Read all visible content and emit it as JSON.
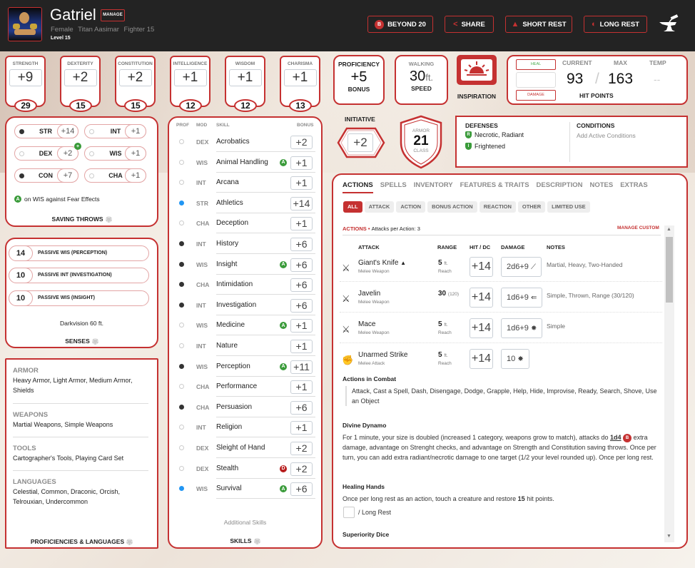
{
  "header": {
    "name": "Gatriel",
    "manage_label": "MANAGE",
    "gender": "Female",
    "race": "Titan Aasimar",
    "class": "Fighter 15",
    "level": "Level 15",
    "buttons": {
      "beyond20": "BEYOND 20",
      "share": "SHARE",
      "short_rest": "SHORT REST",
      "long_rest": "LONG REST"
    }
  },
  "colors": {
    "accent": "#c53131",
    "header_bg": "#232323",
    "advantage": "#3a9b3a",
    "disadvantage": "#b71c1c",
    "proficient_expert": "#2196f3"
  },
  "abilities": [
    {
      "name": "STRENGTH",
      "mod": "+9",
      "score": "29"
    },
    {
      "name": "DEXTERITY",
      "mod": "+2",
      "score": "15"
    },
    {
      "name": "CONSTITUTION",
      "mod": "+2",
      "score": "15"
    },
    {
      "name": "INTELLIGENCE",
      "mod": "+1",
      "score": "12"
    },
    {
      "name": "WISDOM",
      "mod": "+1",
      "score": "12"
    },
    {
      "name": "CHARISMA",
      "mod": "+1",
      "score": "13"
    }
  ],
  "proficiency": {
    "title": "PROFICIENCY",
    "value": "+5",
    "label": "BONUS"
  },
  "speed": {
    "title": "WALKING",
    "value": "30",
    "unit": "ft.",
    "label": "SPEED"
  },
  "inspiration": {
    "label": "INSPIRATION"
  },
  "hit_points": {
    "heal_label": "HEAL",
    "damage_label": "DAMAGE",
    "current_label": "CURRENT",
    "max_label": "MAX",
    "temp_label": "TEMP",
    "current": "93",
    "separator": "/",
    "max": "163",
    "temp": "--",
    "title": "HIT POINTS"
  },
  "saving_throws": {
    "items": [
      {
        "ab": "STR",
        "bonus": "+14",
        "prof": "filled"
      },
      {
        "ab": "INT",
        "bonus": "+1",
        "prof": "empty"
      },
      {
        "ab": "DEX",
        "bonus": "+2",
        "prof": "empty",
        "badge": "+"
      },
      {
        "ab": "WIS",
        "bonus": "+1",
        "prof": "empty"
      },
      {
        "ab": "CON",
        "bonus": "+7",
        "prof": "filled"
      },
      {
        "ab": "CHA",
        "bonus": "+1",
        "prof": "empty"
      }
    ],
    "note_badge": "A",
    "note": "on WIS against Fear Effects",
    "title": "SAVING THROWS"
  },
  "senses": {
    "items": [
      {
        "value": "14",
        "label": "PASSIVE WIS (PERCEPTION)"
      },
      {
        "value": "10",
        "label": "PASSIVE INT (INVESTIGATION)"
      },
      {
        "value": "10",
        "label": "PASSIVE WIS (INSIGHT)"
      }
    ],
    "darkvision": "Darkvision 60 ft.",
    "title": "SENSES"
  },
  "proficiencies": {
    "sections": [
      {
        "heading": "ARMOR",
        "text": "Heavy Armor, Light Armor, Medium Armor, Shields"
      },
      {
        "heading": "WEAPONS",
        "text": "Martial Weapons, Simple Weapons"
      },
      {
        "heading": "TOOLS",
        "text": "Cartographer's Tools, Playing Card Set"
      },
      {
        "heading": "LANGUAGES",
        "text": "Celestial, Common, Draconic, Orcish, Telrouxian, Undercommon"
      }
    ],
    "title": "PROFICIENCIES & LANGUAGES"
  },
  "skills": {
    "headers": {
      "prof": "PROF",
      "mod": "MOD",
      "skill": "SKILL",
      "bonus": "BONUS"
    },
    "items": [
      {
        "mod": "DEX",
        "name": "Acrobatics",
        "bonus": "+2",
        "prof": "empty"
      },
      {
        "mod": "WIS",
        "name": "Animal Handling",
        "bonus": "+1",
        "prof": "empty",
        "badge": "A"
      },
      {
        "mod": "INT",
        "name": "Arcana",
        "bonus": "+1",
        "prof": "empty"
      },
      {
        "mod": "STR",
        "name": "Athletics",
        "bonus": "+14",
        "prof": "blue"
      },
      {
        "mod": "CHA",
        "name": "Deception",
        "bonus": "+1",
        "prof": "empty"
      },
      {
        "mod": "INT",
        "name": "History",
        "bonus": "+6",
        "prof": "filled"
      },
      {
        "mod": "WIS",
        "name": "Insight",
        "bonus": "+6",
        "prof": "filled",
        "badge": "A"
      },
      {
        "mod": "CHA",
        "name": "Intimidation",
        "bonus": "+6",
        "prof": "filled"
      },
      {
        "mod": "INT",
        "name": "Investigation",
        "bonus": "+6",
        "prof": "filled"
      },
      {
        "mod": "WIS",
        "name": "Medicine",
        "bonus": "+1",
        "prof": "empty",
        "badge": "A"
      },
      {
        "mod": "INT",
        "name": "Nature",
        "bonus": "+1",
        "prof": "empty"
      },
      {
        "mod": "WIS",
        "name": "Perception",
        "bonus": "+11",
        "prof": "filled",
        "badge": "A"
      },
      {
        "mod": "CHA",
        "name": "Performance",
        "bonus": "+1",
        "prof": "empty"
      },
      {
        "mod": "CHA",
        "name": "Persuasion",
        "bonus": "+6",
        "prof": "filled"
      },
      {
        "mod": "INT",
        "name": "Religion",
        "bonus": "+1",
        "prof": "empty"
      },
      {
        "mod": "DEX",
        "name": "Sleight of Hand",
        "bonus": "+2",
        "prof": "empty"
      },
      {
        "mod": "DEX",
        "name": "Stealth",
        "bonus": "+2",
        "prof": "empty",
        "badge": "D"
      },
      {
        "mod": "WIS",
        "name": "Survival",
        "bonus": "+6",
        "prof": "blue",
        "badge": "A"
      }
    ],
    "additional": "Additional Skills",
    "title": "SKILLS"
  },
  "initiative": {
    "label": "INITIATIVE",
    "value": "+2"
  },
  "armor_class": {
    "top": "ARMOR",
    "value": "21",
    "bottom": "CLASS"
  },
  "defenses": {
    "title": "DEFENSES",
    "items": [
      {
        "badge": "R",
        "text": "Necrotic, Radiant"
      },
      {
        "badge": "I",
        "text": "Frightened"
      }
    ]
  },
  "conditions": {
    "title": "CONDITIONS",
    "placeholder": "Add Active Conditions"
  },
  "actions_panel": {
    "tabs": [
      "ACTIONS",
      "SPELLS",
      "INVENTORY",
      "FEATURES & TRAITS",
      "DESCRIPTION",
      "NOTES",
      "EXTRAS"
    ],
    "filters": [
      "ALL",
      "ATTACK",
      "ACTION",
      "BONUS ACTION",
      "REACTION",
      "OTHER",
      "LIMITED USE"
    ],
    "section_title": "ACTIONS",
    "attacks_per_action": "Attacks per Action: 3",
    "manage_custom": "MANAGE CUSTOM",
    "columns": {
      "attack": "ATTACK",
      "range": "RANGE",
      "hit": "HIT / DC",
      "damage": "DAMAGE",
      "notes": "NOTES"
    },
    "attacks": [
      {
        "name": "Giant's Knife",
        "type": "Melee Weapon",
        "range": "5",
        "range_unit": "ft.",
        "range_sub": "Reach",
        "hit": "+14",
        "damage": "2d6+9",
        "damage_icon": "slashing",
        "notes": "Martial, Heavy, Two-Handed",
        "warning": true
      },
      {
        "name": "Javelin",
        "type": "Melee Weapon",
        "range": "30",
        "range_unit": "(120)",
        "range_sub": "",
        "hit": "+14",
        "damage": "1d6+9",
        "damage_icon": "piercing",
        "notes": "Simple, Thrown, Range (30/120)"
      },
      {
        "name": "Mace",
        "type": "Melee Weapon",
        "range": "5",
        "range_unit": "ft.",
        "range_sub": "Reach",
        "hit": "+14",
        "damage": "1d6+9",
        "damage_icon": "bludgeoning",
        "notes": "Simple"
      },
      {
        "name": "Unarmed Strike",
        "type": "Melee Attack",
        "range": "5",
        "range_unit": "ft.",
        "range_sub": "Reach",
        "hit": "+14",
        "damage": "10",
        "damage_icon": "bludgeoning",
        "notes": ""
      }
    ],
    "actions_in_combat": {
      "title": "Actions in Combat",
      "text": "Attack, Cast a Spell, Dash, Disengage, Dodge, Grapple, Help, Hide, Improvise, Ready, Search, Shove, Use an Object"
    },
    "divine_dynamo": {
      "title": "Divine Dynamo",
      "text_a": "For 1 minute, your size is doubled (increased 1 category, weapons grow to match), attacks do",
      "dice": "1d4",
      "text_b": "extra damage, advantage on Strenght checks, and advantage on Strength and Constitution saving throws. Once per turn, you can add extra radiant/necrotic damage to one target (1/2 your level rounded up). Once per long rest."
    },
    "healing_hands": {
      "title": "Healing Hands",
      "text_a": "Once per long rest as an action, touch a creature and restore",
      "amount": "15",
      "text_b": "hit points.",
      "uses_label": "/ Long Rest"
    },
    "superiority_dice": {
      "title": "Superiority Dice"
    }
  }
}
